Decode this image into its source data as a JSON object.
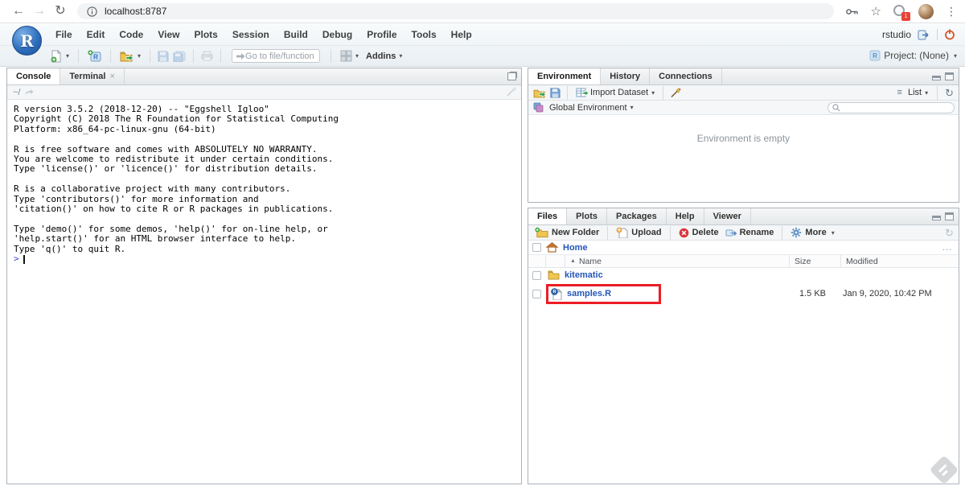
{
  "browser": {
    "url": "localhost:8787",
    "extension_badge": "1"
  },
  "icons": {
    "back": "←",
    "forward": "→",
    "refresh_page": "↻",
    "star": "☆",
    "kebab": "⋮",
    "caret_down": "▾",
    "list_lines": "≡",
    "sort_asc": "▲",
    "close_tab": "×",
    "ellipsis": "...",
    "refresh": "↻"
  },
  "menubar": {
    "logo_letter": "R",
    "items": [
      "File",
      "Edit",
      "Code",
      "View",
      "Plots",
      "Session",
      "Build",
      "Debug",
      "Profile",
      "Tools",
      "Help"
    ],
    "username": "rstudio"
  },
  "main_toolbar": {
    "goto_placeholder": "Go to file/function",
    "addins_label": "Addins",
    "project_label": "Project: (None)"
  },
  "console_panel": {
    "tabs": [
      "Console",
      "Terminal"
    ],
    "path": "~/",
    "lines": [
      "R version 3.5.2 (2018-12-20) -- \"Eggshell Igloo\"",
      "Copyright (C) 2018 The R Foundation for Statistical Computing",
      "Platform: x86_64-pc-linux-gnu (64-bit)",
      "",
      "R is free software and comes with ABSOLUTELY NO WARRANTY.",
      "You are welcome to redistribute it under certain conditions.",
      "Type 'license()' or 'licence()' for distribution details.",
      "",
      "R is a collaborative project with many contributors.",
      "Type 'contributors()' for more information and",
      "'citation()' on how to cite R or R packages in publications.",
      "",
      "Type 'demo()' for some demos, 'help()' for on-line help, or",
      "'help.start()' for an HTML browser interface to help.",
      "Type 'q()' to quit R.",
      ""
    ],
    "prompt": ">"
  },
  "environment_panel": {
    "tabs": [
      "Environment",
      "History",
      "Connections"
    ],
    "import_dataset_label": "Import Dataset",
    "list_label": "List",
    "scope_label": "Global Environment",
    "empty_message": "Environment is empty"
  },
  "files_panel": {
    "tabs": [
      "Files",
      "Plots",
      "Packages",
      "Help",
      "Viewer"
    ],
    "actions": {
      "new_folder": "New Folder",
      "upload": "Upload",
      "delete": "Delete",
      "rename": "Rename",
      "more": "More"
    },
    "breadcrumb": "Home",
    "columns": {
      "name": "Name",
      "size": "Size",
      "modified": "Modified"
    },
    "rows": [
      {
        "name": "kitematic",
        "type": "folder",
        "size": "",
        "modified": ""
      },
      {
        "name": "samples.R",
        "type": "r-script",
        "size": "1.5 KB",
        "modified": "Jan 9, 2020, 10:42 PM",
        "annotated": true
      }
    ]
  },
  "colors": {
    "link_blue": "#2456b8",
    "annotation_red": "#ed1c24",
    "prompt_blue": "#3b47c4",
    "header_gradient_top": "#f8fbfc",
    "header_gradient_bottom": "#eaeff3"
  }
}
